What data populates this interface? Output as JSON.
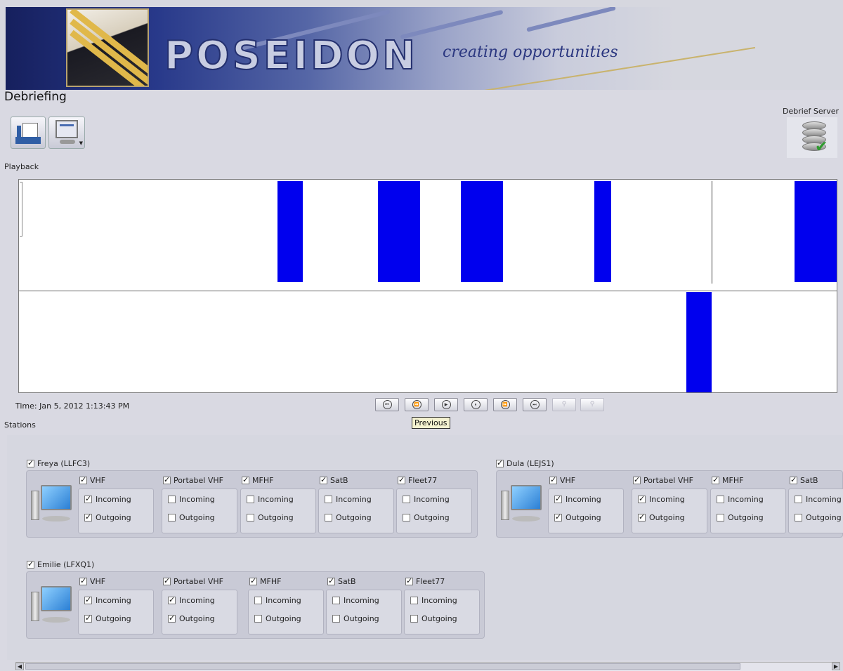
{
  "banner": {
    "logo": "POSEIDON",
    "tagline": "creating opportunities"
  },
  "page": {
    "title": "Debriefing"
  },
  "toolbar": {
    "doc_icon": "document-icon",
    "screen_icon": "monitor-dropdown-icon"
  },
  "server": {
    "label": "Debrief Server",
    "icon": "database-check-icon"
  },
  "playback": {
    "label": "Playback",
    "time": "Time: Jan 5, 2012 1:13:43 PM",
    "clip_color": "#0000ee",
    "tooltip": "Previous",
    "transport": [
      "first",
      "previous",
      "play",
      "pause",
      "next",
      "last",
      "zoom-in",
      "zoom-out"
    ]
  },
  "stations": {
    "label": "Stations",
    "list": [
      {
        "name": "Freya (LLFC3)",
        "checked": true,
        "channels": [
          {
            "name": "VHF",
            "checked": true,
            "incoming": true,
            "outgoing": true
          },
          {
            "name": "Portabel VHF",
            "checked": true,
            "incoming": false,
            "outgoing": false
          },
          {
            "name": "MFHF",
            "checked": true,
            "incoming": false,
            "outgoing": false
          },
          {
            "name": "SatB",
            "checked": true,
            "incoming": false,
            "outgoing": false
          },
          {
            "name": "Fleet77",
            "checked": true,
            "incoming": false,
            "outgoing": false
          }
        ]
      },
      {
        "name": "Dula (LEJS1)",
        "checked": true,
        "channels": [
          {
            "name": "VHF",
            "checked": true,
            "incoming": true,
            "outgoing": true
          },
          {
            "name": "Portabel VHF",
            "checked": true,
            "incoming": true,
            "outgoing": true
          },
          {
            "name": "MFHF",
            "checked": true,
            "incoming": false,
            "outgoing": false
          },
          {
            "name": "SatB",
            "checked": true,
            "incoming": false,
            "outgoing": false
          }
        ]
      },
      {
        "name": "Emilie (LFXQ1)",
        "checked": true,
        "channels": [
          {
            "name": "VHF",
            "checked": true,
            "incoming": true,
            "outgoing": true
          },
          {
            "name": "Portabel VHF",
            "checked": true,
            "incoming": true,
            "outgoing": true
          },
          {
            "name": "MFHF",
            "checked": true,
            "incoming": false,
            "outgoing": false
          },
          {
            "name": "SatB",
            "checked": true,
            "incoming": false,
            "outgoing": false
          },
          {
            "name": "Fleet77",
            "checked": true,
            "incoming": false,
            "outgoing": false
          }
        ]
      }
    ]
  },
  "checkbox_labels": {
    "incoming": "Incoming",
    "outgoing": "Outgoing"
  }
}
